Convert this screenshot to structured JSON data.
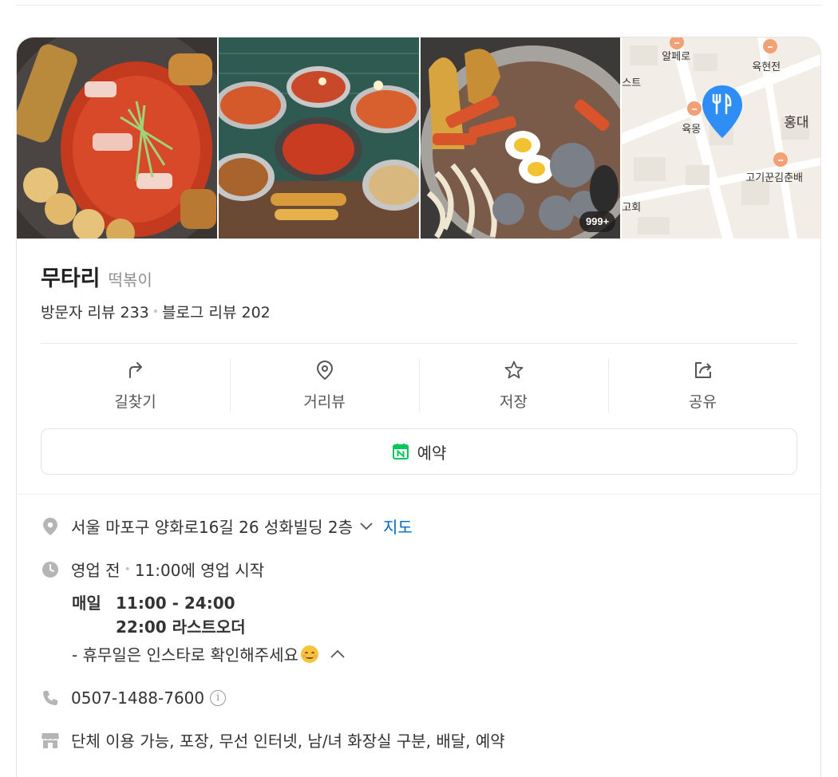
{
  "photos": {
    "more_badge": "999+"
  },
  "map_tile": {
    "labels": [
      "알페로",
      "육현전",
      "스트",
      "육몽",
      "홍대",
      "고기꾼김춘배",
      "고회"
    ],
    "pin_color": "#2f8ef5"
  },
  "place": {
    "name": "무타리",
    "category": "떡볶이",
    "visitor_reviews": "방문자 리뷰 233",
    "blog_reviews": "블로그 리뷰 202"
  },
  "actions": [
    {
      "label": "길찾기",
      "icon": "directions-arrow-icon"
    },
    {
      "label": "거리뷰",
      "icon": "location-pin-icon"
    },
    {
      "label": "저장",
      "icon": "star-icon"
    },
    {
      "label": "공유",
      "icon": "share-icon"
    }
  ],
  "reserve": {
    "label": "예약",
    "icon": "naver-calendar-icon",
    "icon_color": "#03c75a"
  },
  "info": {
    "address": "서울 마포구 양화로16길 26 성화빌딩 2층",
    "map_link": "지도",
    "status": "영업 전",
    "status_detail": "11:00에 영업 시작",
    "hours_day": "매일",
    "hours_time": "11:00 - 24:00",
    "last_order": "22:00 라스트오더",
    "note": "- 휴무일은 인스타로 확인해주세요",
    "phone": "0507-1488-7600",
    "amenities": "단체 이용 가능, 포장, 무선 인터넷, 남/녀 화장실 구분, 배달, 예약"
  },
  "colors": {
    "link": "#0068c3",
    "icon_gray": "#b5b5b5"
  }
}
